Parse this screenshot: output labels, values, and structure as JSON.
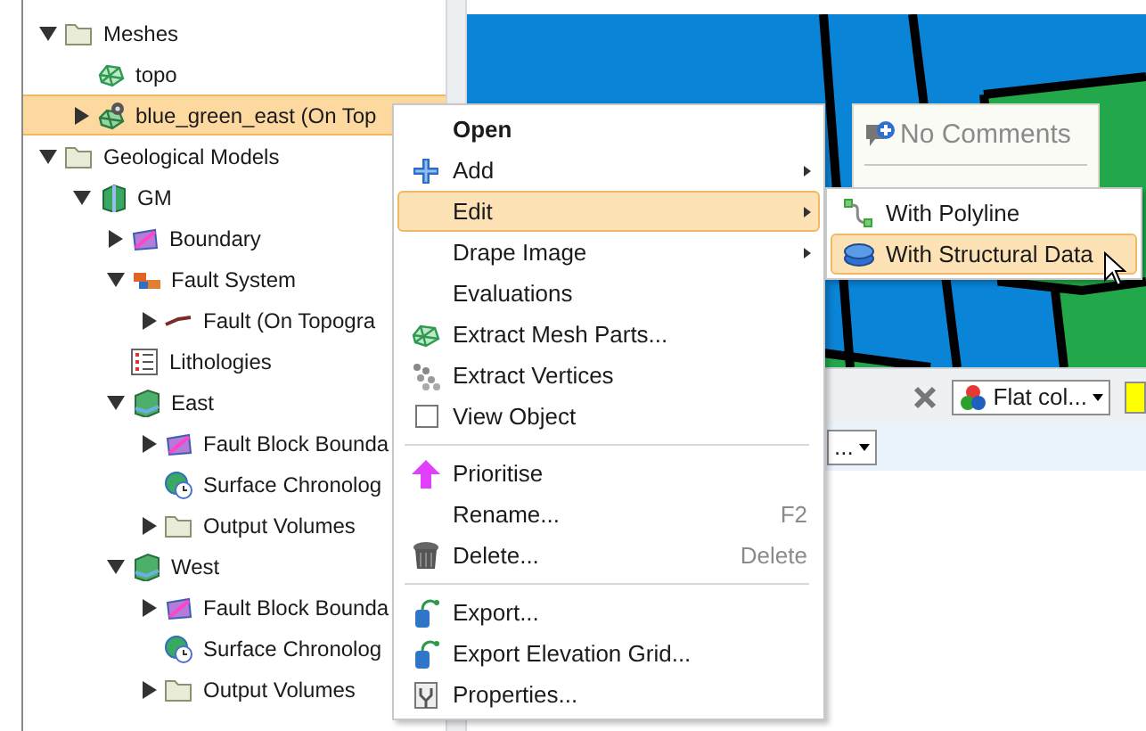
{
  "tree": [
    {
      "label": "Meshes",
      "kind": "folder",
      "expanded": true,
      "selected": false,
      "children": [
        {
          "label": "topo",
          "kind": "mesh",
          "selected": false
        },
        {
          "label": "blue_green_east (On Top",
          "kind": "mesh-gear",
          "expanded": false,
          "selected": true
        }
      ]
    },
    {
      "label": "Geological Models",
      "kind": "folder",
      "expanded": true,
      "selected": false,
      "children": [
        {
          "label": "GM",
          "kind": "model",
          "expanded": true,
          "selected": false,
          "children": [
            {
              "label": "Boundary",
              "kind": "boundary",
              "expanded": false,
              "selected": false
            },
            {
              "label": "Fault System",
              "kind": "fault-system",
              "expanded": true,
              "selected": false,
              "children": [
                {
                  "label": "Fault (On Topogra",
                  "kind": "fault",
                  "expanded": false,
                  "selected": false
                }
              ]
            },
            {
              "label": "Lithologies",
              "kind": "list",
              "selected": false
            },
            {
              "label": "East",
              "kind": "block",
              "expanded": true,
              "selected": false,
              "children": [
                {
                  "label": "Fault Block Bounda",
                  "kind": "boundary",
                  "expanded": false,
                  "selected": false
                },
                {
                  "label": "Surface Chronolog",
                  "kind": "chronology",
                  "selected": false
                },
                {
                  "label": "Output Volumes",
                  "kind": "folder",
                  "expanded": false,
                  "selected": false
                }
              ]
            },
            {
              "label": "West",
              "kind": "block",
              "expanded": true,
              "selected": false,
              "children": [
                {
                  "label": "Fault Block Bounda",
                  "kind": "boundary",
                  "expanded": false,
                  "selected": false
                },
                {
                  "label": "Surface Chronolog",
                  "kind": "chronology",
                  "selected": false
                },
                {
                  "label": "Output Volumes",
                  "kind": "folder",
                  "expanded": false,
                  "selected": false
                }
              ]
            }
          ]
        }
      ]
    }
  ],
  "comment_popup": {
    "title": "No Comments"
  },
  "toolbar": {
    "color_mode": "Flat col..."
  },
  "property_dropdown": {
    "value": "..."
  },
  "context_menu": [
    {
      "kind": "item",
      "label": "Open",
      "default": true,
      "submenu": false,
      "selected": false
    },
    {
      "kind": "item",
      "label": "Add",
      "default": false,
      "submenu": true,
      "selected": false
    },
    {
      "kind": "item",
      "label": "Edit",
      "default": false,
      "submenu": true,
      "selected": true
    },
    {
      "kind": "item",
      "label": "Drape Image",
      "default": false,
      "submenu": true,
      "selected": false
    },
    {
      "kind": "item",
      "label": "Evaluations",
      "default": false,
      "submenu": false,
      "selected": false
    },
    {
      "kind": "item",
      "label": "Extract Mesh Parts...",
      "default": false,
      "submenu": false,
      "selected": false
    },
    {
      "kind": "item",
      "label": "Extract Vertices",
      "default": false,
      "submenu": false,
      "selected": false
    },
    {
      "kind": "check",
      "label": "View Object",
      "checked": false,
      "selected": false
    },
    {
      "kind": "separator"
    },
    {
      "kind": "item",
      "label": "Prioritise",
      "default": false,
      "submenu": false,
      "selected": false
    },
    {
      "kind": "item",
      "label": "Rename...",
      "shortcut": "F2",
      "default": false,
      "submenu": false,
      "selected": false
    },
    {
      "kind": "item",
      "label": "Delete...",
      "shortcut": "Delete",
      "default": false,
      "submenu": false,
      "selected": false
    },
    {
      "kind": "separator"
    },
    {
      "kind": "item",
      "label": "Export...",
      "default": false,
      "submenu": false,
      "selected": false
    },
    {
      "kind": "item",
      "label": "Export Elevation Grid...",
      "default": false,
      "submenu": false,
      "selected": false
    },
    {
      "kind": "item",
      "label": "Properties...",
      "default": false,
      "submenu": false,
      "selected": false
    }
  ],
  "submenu": [
    {
      "label": "With Polyline",
      "selected": false
    },
    {
      "label": "With Structural Data",
      "selected": true
    }
  ]
}
